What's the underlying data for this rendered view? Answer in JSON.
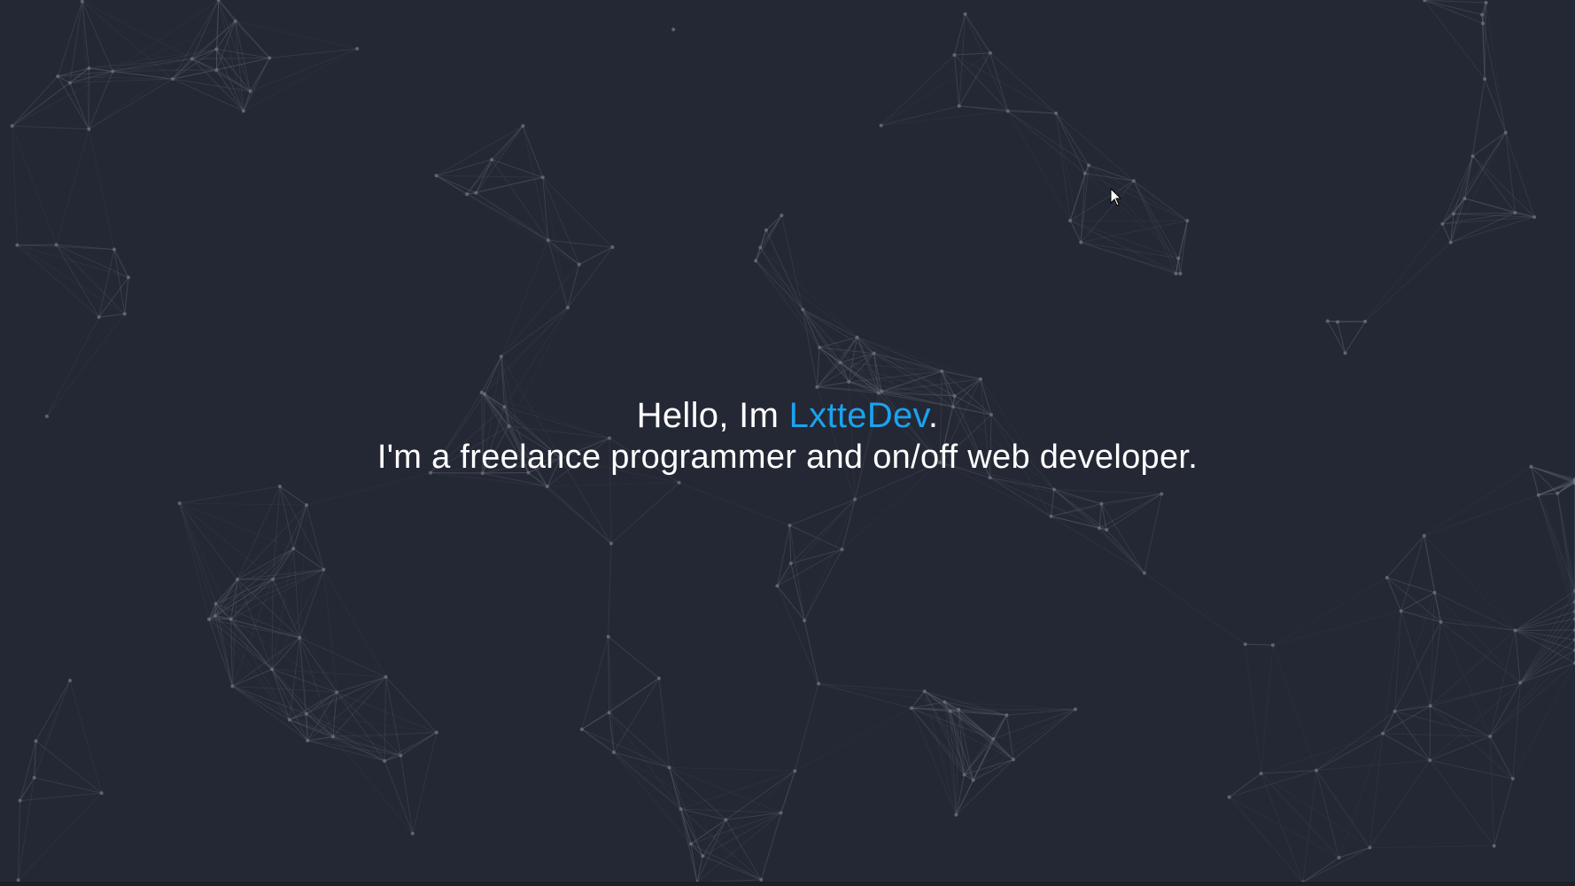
{
  "hero": {
    "greeting_prefix": "Hello, Im ",
    "name": "LxtteDev",
    "greeting_suffix": ".",
    "subtitle": "I'm a freelance programmer and on/off web developer."
  },
  "colors": {
    "background": "#242834",
    "accent": "#1aa3f0",
    "text": "#ffffff",
    "particle_line": "#5a5f6c",
    "particle_dot": "#6b7080"
  },
  "icons": {
    "cursor": "mouse-pointer-icon"
  }
}
